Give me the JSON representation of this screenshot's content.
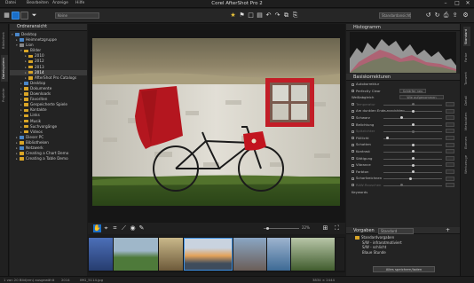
{
  "app": {
    "title": "Corel AfterShot Pro 2"
  },
  "menu": {
    "items": [
      "Datei",
      "Bearbeiten",
      "Anzeige",
      "Hilfe"
    ]
  },
  "window_controls": {
    "minimize": "–",
    "maximize": "□",
    "close": "✕"
  },
  "toolbar": {
    "rating_filter": "Keine",
    "view_mode": "Standardansicht",
    "rotate_left": "↶",
    "rotate_right": "↷"
  },
  "left_strip": {
    "tabs": [
      "Bibliothek",
      "Dateisystem",
      "Projekte"
    ]
  },
  "left_panel": {
    "title": "Ordneransicht",
    "tree": [
      {
        "label": "Desktop",
        "depth": 0,
        "icon": "blue",
        "open": true
      },
      {
        "label": "Heimnetzgruppe",
        "depth": 1,
        "icon": "blue"
      },
      {
        "label": "Lion",
        "depth": 1,
        "icon": "gray",
        "open": true
      },
      {
        "label": "Bilder",
        "depth": 2,
        "icon": "folder",
        "open": true
      },
      {
        "label": "2010",
        "depth": 3,
        "icon": "folder"
      },
      {
        "label": "2012",
        "depth": 3,
        "icon": "folder"
      },
      {
        "label": "2013",
        "depth": 3,
        "icon": "folder"
      },
      {
        "label": "2014",
        "depth": 3,
        "icon": "folder",
        "selected": true
      },
      {
        "label": "AfterShot Pro Catalogs",
        "depth": 3,
        "icon": "folder"
      },
      {
        "label": "Desktop",
        "depth": 2,
        "icon": "blue"
      },
      {
        "label": "Dokumente",
        "depth": 2,
        "icon": "folder"
      },
      {
        "label": "Downloads",
        "depth": 2,
        "icon": "folder"
      },
      {
        "label": "Favoriten",
        "depth": 2,
        "icon": "folder"
      },
      {
        "label": "Gespeicherte Spiele",
        "depth": 2,
        "icon": "folder"
      },
      {
        "label": "Kontakte",
        "depth": 2,
        "icon": "folder"
      },
      {
        "label": "Links",
        "depth": 2,
        "icon": "folder"
      },
      {
        "label": "Musik",
        "depth": 2,
        "icon": "folder"
      },
      {
        "label": "Suchvorgänge",
        "depth": 2,
        "icon": "folder"
      },
      {
        "label": "Videos",
        "depth": 2,
        "icon": "folder"
      },
      {
        "label": "Dieser PC",
        "depth": 1,
        "icon": "blue"
      },
      {
        "label": "Bibliotheken",
        "depth": 1,
        "icon": "folder"
      },
      {
        "label": "Netzwerk",
        "depth": 1,
        "icon": "blue"
      },
      {
        "label": "Creating a Chart Demo",
        "depth": 1,
        "icon": "folder"
      },
      {
        "label": "Creating a Table Demo",
        "depth": 1,
        "icon": "folder"
      }
    ]
  },
  "viewer": {
    "zoom": "22%"
  },
  "histogram": {
    "title": "Histogramm"
  },
  "basic": {
    "title": "Basiskorrekturen",
    "auto_correct": "Autokorrektur",
    "perfectly_clear": "Perfectly Clear",
    "perfectly_clear_value": "Schärfer neu",
    "white_balance": "Weißabgleich",
    "white_balance_value": "Wie aufgenommen",
    "rows": [
      {
        "label": "Temperatur",
        "pos": 0.5,
        "dim": true
      },
      {
        "label": "Am dunklen Ende ausrichten",
        "pos": 0.5
      },
      {
        "label": "Schwarz",
        "pos": 0.3
      },
      {
        "label": "Belichtung",
        "pos": 0.5
      },
      {
        "label": "Spitzlichter",
        "pos": 0.5,
        "dim": true
      },
      {
        "label": "Fülllicht",
        "pos": 0.05
      },
      {
        "label": "Schatten",
        "pos": 0.5
      },
      {
        "label": "Kontrast",
        "pos": 0.5
      },
      {
        "label": "Sättigung",
        "pos": 0.5
      },
      {
        "label": "Vibrance",
        "pos": 0.5
      },
      {
        "label": "Farbton",
        "pos": 0.5
      },
      {
        "label": "Scharfzeichnen",
        "pos": 0.45
      },
      {
        "label": "RAW-Rauschen",
        "pos": 0.3,
        "dim": true
      }
    ],
    "keywords": "Keywords"
  },
  "presets": {
    "title": "Vorgaben",
    "filter": "Standard",
    "items": [
      "Standardvorgaben",
      "S/W - infrarotmotiviert",
      "S/W - schlicht",
      "Blaue Stunde"
    ],
    "save_button": "Alles speichern/laden"
  },
  "right_strip": {
    "tabs": [
      "Standard",
      "Farbe",
      "Tonwert",
      "Detail",
      "Metadaten",
      "Ebenen",
      "Werkzeuge"
    ]
  },
  "status": {
    "left": "1 von 20 Bild(ern) ausgewählt",
    "folder": "2014",
    "file": "IMG_5114.jpg",
    "dims": "3834 × 2444"
  }
}
